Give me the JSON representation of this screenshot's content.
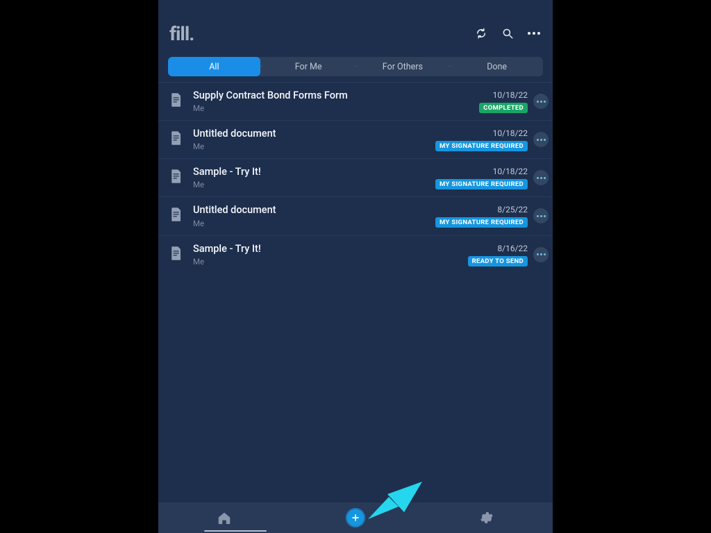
{
  "app": {
    "name": "fill."
  },
  "header_icons": {
    "sync": "sync-icon",
    "search": "search-icon",
    "more": "more-icon"
  },
  "tabs": [
    {
      "label": "All",
      "active": true
    },
    {
      "label": "For Me",
      "active": false
    },
    {
      "label": "For Others",
      "active": false
    },
    {
      "label": "Done",
      "active": false
    }
  ],
  "documents": [
    {
      "title": "Supply Contract Bond Forms Form",
      "owner": "Me",
      "date": "10/18/22",
      "status_label": "COMPLETED",
      "status_kind": "completed"
    },
    {
      "title": "Untitled document",
      "owner": "Me",
      "date": "10/18/22",
      "status_label": "MY SIGNATURE REQUIRED",
      "status_kind": "sig"
    },
    {
      "title": "Sample - Try It!",
      "owner": "Me",
      "date": "10/18/22",
      "status_label": "MY SIGNATURE REQUIRED",
      "status_kind": "sig"
    },
    {
      "title": "Untitled document",
      "owner": "Me",
      "date": "8/25/22",
      "status_label": "MY SIGNATURE REQUIRED",
      "status_kind": "sig"
    },
    {
      "title": "Sample - Try It!",
      "owner": "Me",
      "date": "8/16/22",
      "status_label": "READY TO SEND",
      "status_kind": "ready"
    }
  ],
  "bottombar": {
    "home": "home-icon",
    "add": "add-icon",
    "settings": "settings-icon"
  },
  "colors": {
    "accent": "#1596e0",
    "completed": "#1aa566",
    "bg": "#1d2f4d"
  }
}
